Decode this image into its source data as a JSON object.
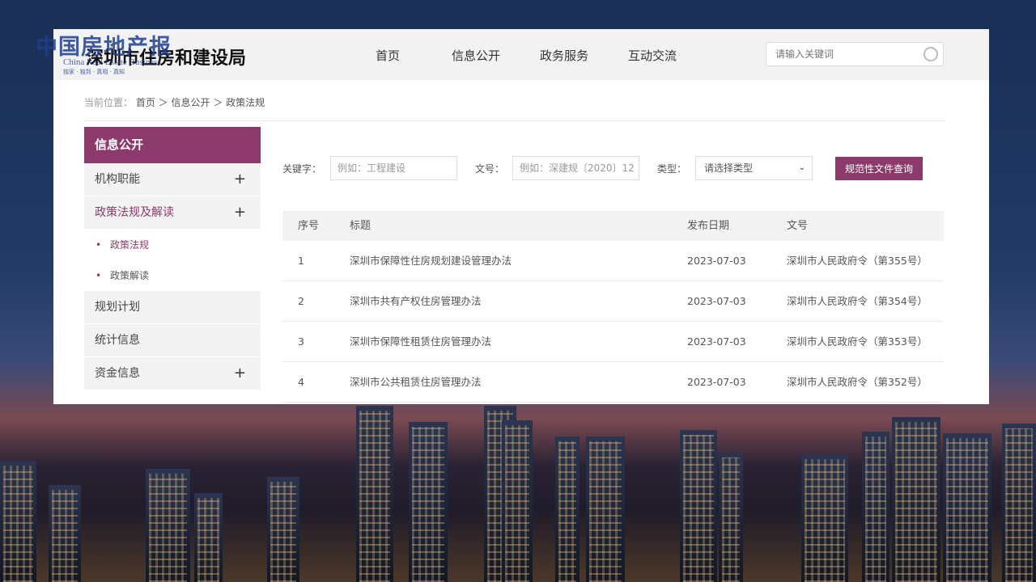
{
  "watermark": {
    "title": "中国房地产报",
    "english": "China Real Estate Business",
    "tagline": "独家 · 独到 · 真相 · 真知"
  },
  "header": {
    "site_title": "深圳市住房和建设局",
    "nav": [
      "首页",
      "信息公开",
      "政务服务",
      "互动交流"
    ],
    "search_placeholder": "请输入关键词"
  },
  "breadcrumb": {
    "prefix": "当前位置：",
    "path": "首页 ＞ 信息公开 ＞ 政策法规"
  },
  "sidebar": {
    "heading": "信息公开",
    "items": [
      {
        "label": "机构职能",
        "expandable": true
      },
      {
        "label": "政策法规及解读",
        "expandable": true,
        "active": true
      },
      {
        "label": "政策法规",
        "sub": true,
        "current": true
      },
      {
        "label": "政策解读",
        "sub": true
      },
      {
        "label": "规划计划",
        "expandable": false
      },
      {
        "label": "统计信息",
        "expandable": false
      },
      {
        "label": "资金信息",
        "expandable": true
      }
    ]
  },
  "filter": {
    "keyword_label": "关键字：",
    "keyword_placeholder": "例如：工程建设",
    "docno_label": "文号：",
    "docno_placeholder": "例如：深建规〔2020〕12",
    "type_label": "类型：",
    "type_value": "请选择类型",
    "query_button": "规范性文件查询"
  },
  "table": {
    "headers": [
      "序号",
      "标题",
      "发布日期",
      "文号"
    ],
    "rows": [
      [
        "1",
        "深圳市保障性住房规划建设管理办法",
        "2023-07-03",
        "深圳市人民政府令（第355号）"
      ],
      [
        "2",
        "深圳市共有产权住房管理办法",
        "2023-07-03",
        "深圳市人民政府令（第354号）"
      ],
      [
        "3",
        "深圳市保障性租赁住房管理办法",
        "2023-07-03",
        "深圳市人民政府令（第353号）"
      ],
      [
        "4",
        "深圳市公共租赁住房管理办法",
        "2023-07-03",
        "深圳市人民政府令（第352号）"
      ]
    ]
  },
  "colors": {
    "accent": "#8c3a6b",
    "header_bg": "#f2f2f2"
  }
}
